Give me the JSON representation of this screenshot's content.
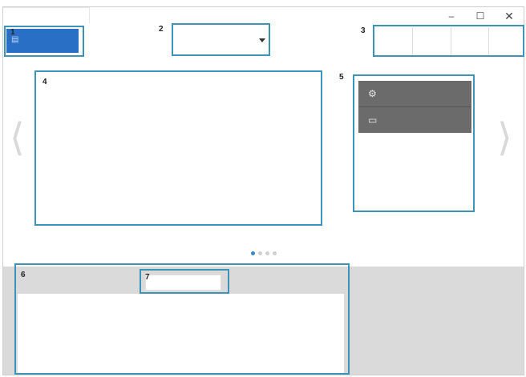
{
  "window": {
    "controls": {
      "minimize_icon": "minimize-icon",
      "maximize_icon": "maximize-icon",
      "close_icon": "close-icon",
      "minimize_glyph": "–",
      "maximize_glyph": "☐",
      "close_glyph": "✕"
    }
  },
  "callouts": {
    "n1": "1",
    "n2": "2",
    "n3": "3",
    "n4": "4",
    "n5": "5",
    "n6": "6",
    "n7": "7"
  },
  "panel": {
    "items": [
      {
        "icon": "settings-icon",
        "glyph": "⚙"
      },
      {
        "icon": "window-icon",
        "glyph": "▭"
      }
    ]
  },
  "carousel": {
    "prev_glyph": "⟨",
    "next_glyph": "⟩",
    "page_count": 4,
    "active_page": 1
  },
  "colors": {
    "callout_border": "#3d93b8",
    "home_button": "#2a6fc6",
    "panel_item": "#6b6b6b",
    "dot_active": "#3a86c8"
  }
}
